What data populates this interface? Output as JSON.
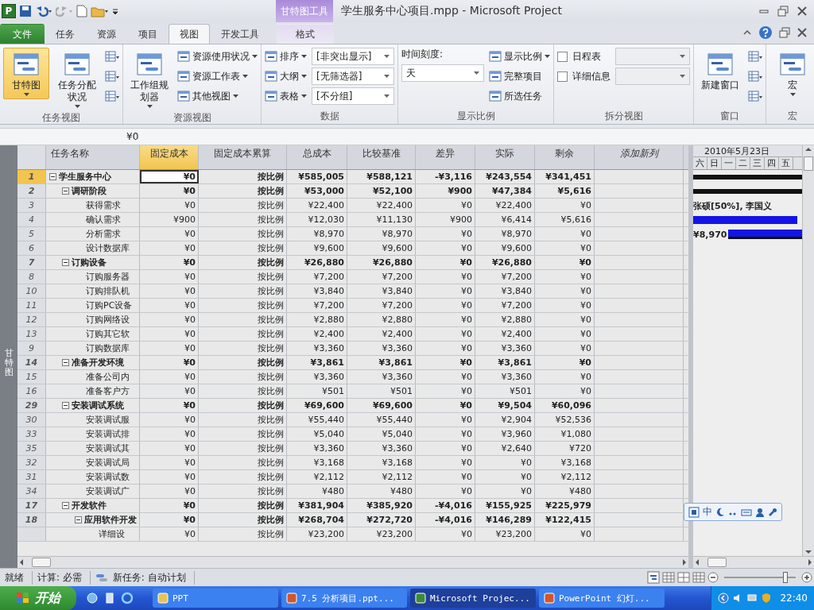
{
  "quick_access": {
    "logo": "P"
  },
  "window": {
    "title": "学生服务中心项目.mpp  -  Microsoft Project",
    "context_tab": "甘特图工具"
  },
  "tabs": [
    {
      "label": "文件",
      "kind": "file",
      "selected": false
    },
    {
      "label": "任务",
      "kind": "tab",
      "selected": false
    },
    {
      "label": "资源",
      "kind": "tab",
      "selected": false
    },
    {
      "label": "项目",
      "kind": "tab",
      "selected": false
    },
    {
      "label": "视图",
      "kind": "tab",
      "selected": true
    },
    {
      "label": "开发工具",
      "kind": "tab",
      "selected": false
    },
    {
      "label": "格式",
      "kind": "context",
      "selected": false
    }
  ],
  "ribbon": [
    {
      "label": "任务视图",
      "columns": [
        [
          {
            "kind": "large",
            "label": "甘特图",
            "caret": true,
            "selected": true
          }
        ],
        [
          {
            "kind": "large",
            "label": "任务分配状况",
            "caret": true,
            "selected": false
          }
        ],
        [
          {
            "kind": "icon"
          },
          {
            "kind": "icon"
          },
          {
            "kind": "icon"
          }
        ]
      ]
    },
    {
      "label": "资源视图",
      "columns": [
        [
          {
            "kind": "large",
            "label": "工作组规划器",
            "caret": true,
            "selected": false
          }
        ],
        [
          {
            "kind": "small",
            "label": "资源使用状况",
            "caret": true
          },
          {
            "kind": "small",
            "label": "资源工作表",
            "caret": true
          },
          {
            "kind": "small",
            "label": "其他视图",
            "caret": true
          }
        ]
      ]
    },
    {
      "label": "数据",
      "columns": [
        [
          {
            "kind": "small",
            "label": "排序",
            "caret": true
          },
          {
            "kind": "small",
            "label": "大纲",
            "caret": true
          },
          {
            "kind": "small",
            "label": "表格",
            "caret": true
          }
        ],
        [
          {
            "kind": "select",
            "value": "[非突出显示]"
          },
          {
            "kind": "select",
            "value": "[无筛选器]"
          },
          {
            "kind": "select",
            "value": "[不分组]"
          }
        ]
      ]
    },
    {
      "label": "显示比例",
      "columns": [
        [
          {
            "kind": "caption",
            "label": "时间刻度:"
          },
          {
            "kind": "select",
            "value": "天"
          }
        ],
        [
          {
            "kind": "small",
            "label": "显示比例",
            "caret": true
          },
          {
            "kind": "small",
            "label": "完整项目",
            "caret": false
          },
          {
            "kind": "small",
            "label": "所选任务",
            "caret": false
          }
        ]
      ]
    },
    {
      "label": "拆分视图",
      "columns": [
        [
          {
            "kind": "checkbox",
            "label": "日程表",
            "checked": false
          },
          {
            "kind": "checkbox",
            "label": "详细信息",
            "checked": false
          }
        ],
        [
          {
            "kind": "select"
          },
          {
            "kind": "select"
          }
        ]
      ]
    },
    {
      "label": "窗口",
      "columns": [
        [
          {
            "kind": "large",
            "label": "新建窗口",
            "caret": false,
            "selected": false
          }
        ],
        [
          {
            "kind": "icon"
          },
          {
            "kind": "icon"
          },
          {
            "kind": "icon"
          }
        ]
      ]
    },
    {
      "label": "宏",
      "columns": [
        [
          {
            "kind": "large",
            "label": "宏",
            "caret": true,
            "selected": false
          }
        ]
      ]
    }
  ],
  "formula_bar": {
    "value": "¥0"
  },
  "view_bar": {
    "label": "甘特图"
  },
  "table": {
    "name_column": {
      "label": "任务名称",
      "selected": false
    },
    "columns": [
      {
        "label": "固定成本",
        "kind": "value",
        "selected": true
      },
      {
        "label": "固定成本累算",
        "kind": "value",
        "selected": false
      },
      {
        "label": "总成本",
        "kind": "value",
        "selected": false
      },
      {
        "label": "比较基准",
        "kind": "value",
        "selected": false
      },
      {
        "label": "差异",
        "kind": "value",
        "selected": false
      },
      {
        "label": "实际",
        "kind": "value",
        "selected": false
      },
      {
        "label": "剩余",
        "kind": "value",
        "selected": false
      },
      {
        "label": "添加新列",
        "kind": "add",
        "selected": false
      }
    ],
    "rows": [
      {
        "id": "1",
        "name": "学生服务中心",
        "selected": true,
        "expanded": true,
        "cells": [
          "¥0",
          "按比例",
          "¥585,005",
          "¥588,121",
          "-¥3,116",
          "¥243,554",
          "¥341,451"
        ],
        "children": [
          {
            "id": "2",
            "name": "调研阶段",
            "selected": false,
            "expanded": true,
            "cells": [
              "¥0",
              "按比例",
              "¥53,000",
              "¥52,100",
              "¥900",
              "¥47,384",
              "¥5,616"
            ],
            "children": [
              {
                "id": "3",
                "name": "获得需求",
                "selected": false,
                "cells": [
                  "¥0",
                  "按比例",
                  "¥22,400",
                  "¥22,400",
                  "¥0",
                  "¥22,400",
                  "¥0"
                ]
              },
              {
                "id": "4",
                "name": "确认需求",
                "selected": false,
                "cells": [
                  "¥900",
                  "按比例",
                  "¥12,030",
                  "¥11,130",
                  "¥900",
                  "¥6,414",
                  "¥5,616"
                ]
              },
              {
                "id": "5",
                "name": "分析需求",
                "selected": false,
                "cells": [
                  "¥0",
                  "按比例",
                  "¥8,970",
                  "¥8,970",
                  "¥0",
                  "¥8,970",
                  "¥0"
                ]
              },
              {
                "id": "6",
                "name": "设计数据库",
                "selected": false,
                "cells": [
                  "¥0",
                  "按比例",
                  "¥9,600",
                  "¥9,600",
                  "¥0",
                  "¥9,600",
                  "¥0"
                ]
              }
            ]
          },
          {
            "id": "7",
            "name": "订购设备",
            "selected": false,
            "expanded": true,
            "cells": [
              "¥0",
              "按比例",
              "¥26,880",
              "¥26,880",
              "¥0",
              "¥26,880",
              "¥0"
            ],
            "children": [
              {
                "id": "8",
                "name": "订购服务器",
                "selected": false,
                "cells": [
                  "¥0",
                  "按比例",
                  "¥7,200",
                  "¥7,200",
                  "¥0",
                  "¥7,200",
                  "¥0"
                ]
              },
              {
                "id": "10",
                "name": "订购排队机",
                "selected": false,
                "cells": [
                  "¥0",
                  "按比例",
                  "¥3,840",
                  "¥3,840",
                  "¥0",
                  "¥3,840",
                  "¥0"
                ]
              },
              {
                "id": "11",
                "name": "订购PC设备",
                "selected": false,
                "cells": [
                  "¥0",
                  "按比例",
                  "¥7,200",
                  "¥7,200",
                  "¥0",
                  "¥7,200",
                  "¥0"
                ]
              },
              {
                "id": "12",
                "name": "订购网络设",
                "selected": false,
                "cells": [
                  "¥0",
                  "按比例",
                  "¥2,880",
                  "¥2,880",
                  "¥0",
                  "¥2,880",
                  "¥0"
                ]
              },
              {
                "id": "13",
                "name": "订购其它软",
                "selected": false,
                "cells": [
                  "¥0",
                  "按比例",
                  "¥2,400",
                  "¥2,400",
                  "¥0",
                  "¥2,400",
                  "¥0"
                ]
              },
              {
                "id": "9",
                "name": "订购数据库",
                "selected": false,
                "cells": [
                  "¥0",
                  "按比例",
                  "¥3,360",
                  "¥3,360",
                  "¥0",
                  "¥3,360",
                  "¥0"
                ]
              }
            ]
          },
          {
            "id": "14",
            "name": "准备开发环境",
            "selected": false,
            "expanded": true,
            "cells": [
              "¥0",
              "按比例",
              "¥3,861",
              "¥3,861",
              "¥0",
              "¥3,861",
              "¥0"
            ],
            "children": [
              {
                "id": "15",
                "name": "准备公司内",
                "selected": false,
                "cells": [
                  "¥0",
                  "按比例",
                  "¥3,360",
                  "¥3,360",
                  "¥0",
                  "¥3,360",
                  "¥0"
                ]
              },
              {
                "id": "16",
                "name": "准备客户方",
                "selected": false,
                "cells": [
                  "¥0",
                  "按比例",
                  "¥501",
                  "¥501",
                  "¥0",
                  "¥501",
                  "¥0"
                ]
              }
            ]
          },
          {
            "id": "29",
            "name": "安装调试系统",
            "selected": false,
            "expanded": true,
            "cells": [
              "¥0",
              "按比例",
              "¥69,600",
              "¥69,600",
              "¥0",
              "¥9,504",
              "¥60,096"
            ],
            "children": [
              {
                "id": "30",
                "name": "安装调试服",
                "selected": false,
                "cells": [
                  "¥0",
                  "按比例",
                  "¥55,440",
                  "¥55,440",
                  "¥0",
                  "¥2,904",
                  "¥52,536"
                ]
              },
              {
                "id": "33",
                "name": "安装调试排",
                "selected": false,
                "cells": [
                  "¥0",
                  "按比例",
                  "¥5,040",
                  "¥5,040",
                  "¥0",
                  "¥3,960",
                  "¥1,080"
                ]
              },
              {
                "id": "35",
                "name": "安装调试其",
                "selected": false,
                "cells": [
                  "¥0",
                  "按比例",
                  "¥3,360",
                  "¥3,360",
                  "¥0",
                  "¥2,640",
                  "¥720"
                ]
              },
              {
                "id": "32",
                "name": "安装调试局",
                "selected": false,
                "cells": [
                  "¥0",
                  "按比例",
                  "¥3,168",
                  "¥3,168",
                  "¥0",
                  "¥0",
                  "¥3,168"
                ]
              },
              {
                "id": "31",
                "name": "安装调试数",
                "selected": false,
                "cells": [
                  "¥0",
                  "按比例",
                  "¥2,112",
                  "¥2,112",
                  "¥0",
                  "¥0",
                  "¥2,112"
                ]
              },
              {
                "id": "34",
                "name": "安装调试广",
                "selected": false,
                "cells": [
                  "¥0",
                  "按比例",
                  "¥480",
                  "¥480",
                  "¥0",
                  "¥0",
                  "¥480"
                ]
              }
            ]
          },
          {
            "id": "17",
            "name": "开发软件",
            "selected": false,
            "expanded": true,
            "cells": [
              "¥0",
              "按比例",
              "¥381,904",
              "¥385,920",
              "-¥4,016",
              "¥155,925",
              "¥225,979"
            ],
            "children": [
              {
                "id": "18",
                "name": "应用软件开发",
                "selected": false,
                "expanded": true,
                "cells": [
                  "¥0",
                  "按比例",
                  "¥268,704",
                  "¥272,720",
                  "-¥4,016",
                  "¥146,289",
                  "¥122,415"
                ],
                "children": [
                  {
                    "name": "详细设",
                    "selected": false,
                    "cells": [
                      "¥0",
                      "按比例",
                      "¥23,200",
                      "¥23,200",
                      "¥0",
                      "¥23,200",
                      "¥0"
                    ]
                  }
                ]
              }
            ]
          }
        ]
      }
    ]
  },
  "gantt": {
    "date": "2010年5月23日",
    "days": [
      "六",
      "日",
      "一",
      "二",
      "三",
      "四",
      "五"
    ],
    "rows": [
      {
        "kind": "summary"
      },
      {
        "kind": "summary"
      },
      {
        "kind": "label",
        "text": "张硕[50%], 李国义"
      },
      {
        "kind": "task"
      },
      {
        "kind": "task",
        "text": "¥8,970"
      }
    ]
  },
  "ime_bar": {
    "mode": "中"
  },
  "status_bar": {
    "items": [
      "就绪",
      "计算: 必需",
      "新任务: 自动计划"
    ],
    "zoom": {
      "level": 0.85
    }
  },
  "taskbar": {
    "start": "开始",
    "tasks": [
      {
        "label": "PPT",
        "kind": "folder",
        "selected": false
      },
      {
        "label": "7.5 分析项目.ppt...",
        "kind": "ppt",
        "selected": false
      },
      {
        "label": "Microsoft Projec...",
        "kind": "project",
        "selected": true
      },
      {
        "label": "PowerPoint 幻灯...",
        "kind": "slides",
        "selected": false
      }
    ],
    "clock": "22:40"
  }
}
